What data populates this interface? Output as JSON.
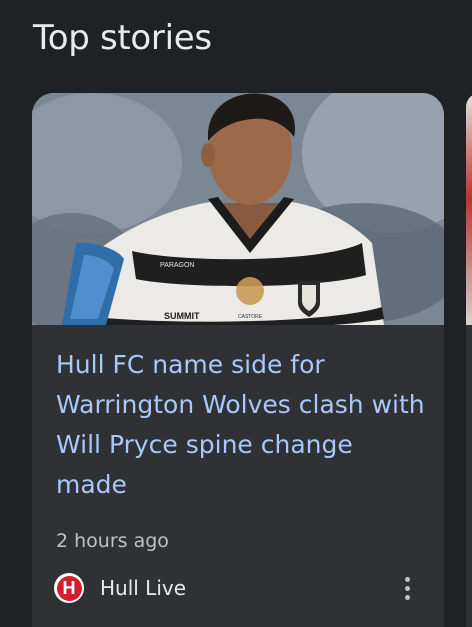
{
  "section": {
    "title": "Top stories"
  },
  "story": {
    "headline": "Hull FC name side for Warrington Wolves clash with Will Pryce spine change made",
    "timestamp": "2 hours ago",
    "publisher": {
      "name": "Hull Live",
      "logo_letter": "H",
      "logo_icon": "hull-live-logo-icon"
    },
    "thumbnail": {
      "jersey_texts": [
        "PARAGON",
        "SUMMIT",
        "CASTORE"
      ]
    },
    "more_icon": "more-vert-icon"
  },
  "colors": {
    "background": "#202124",
    "card": "#303134",
    "headline": "#a8c7fa",
    "secondary_text": "#bdc1c6",
    "primary_text": "#e8eaed",
    "logo_red": "#d21f2b"
  }
}
